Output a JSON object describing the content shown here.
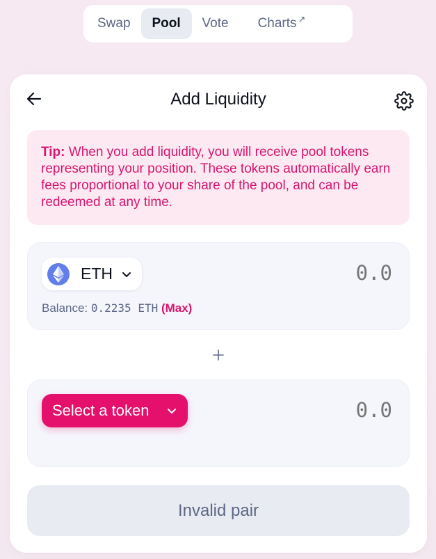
{
  "nav": {
    "items": [
      {
        "label": "Swap"
      },
      {
        "label": "Pool"
      },
      {
        "label": "Vote"
      },
      {
        "label": "Charts"
      }
    ],
    "charts_external_mark": "↗",
    "active": "Pool"
  },
  "card": {
    "title": "Add Liquidity"
  },
  "tip": {
    "label": "Tip:",
    "text": " When you add liquidity, you will receive pool tokens representing your position. These tokens automatically earn fees proportional to your share of the pool, and can be redeemed at any time."
  },
  "input_a": {
    "token_symbol": "ETH",
    "token_icon": "ethereum-icon",
    "amount_placeholder": "0.0",
    "balance_label": "Balance: ",
    "balance_value": "0.2235 ETH",
    "max_label": "(Max)"
  },
  "plus_icon": "plus-icon",
  "input_b": {
    "select_label": "Select a token",
    "amount_placeholder": "0.0"
  },
  "submit": {
    "label": "Invalid pair"
  },
  "colors": {
    "accent": "#e5106b",
    "tip_bg": "#fde9f1",
    "tip_text": "#d6166f",
    "eth": "#627eea"
  }
}
